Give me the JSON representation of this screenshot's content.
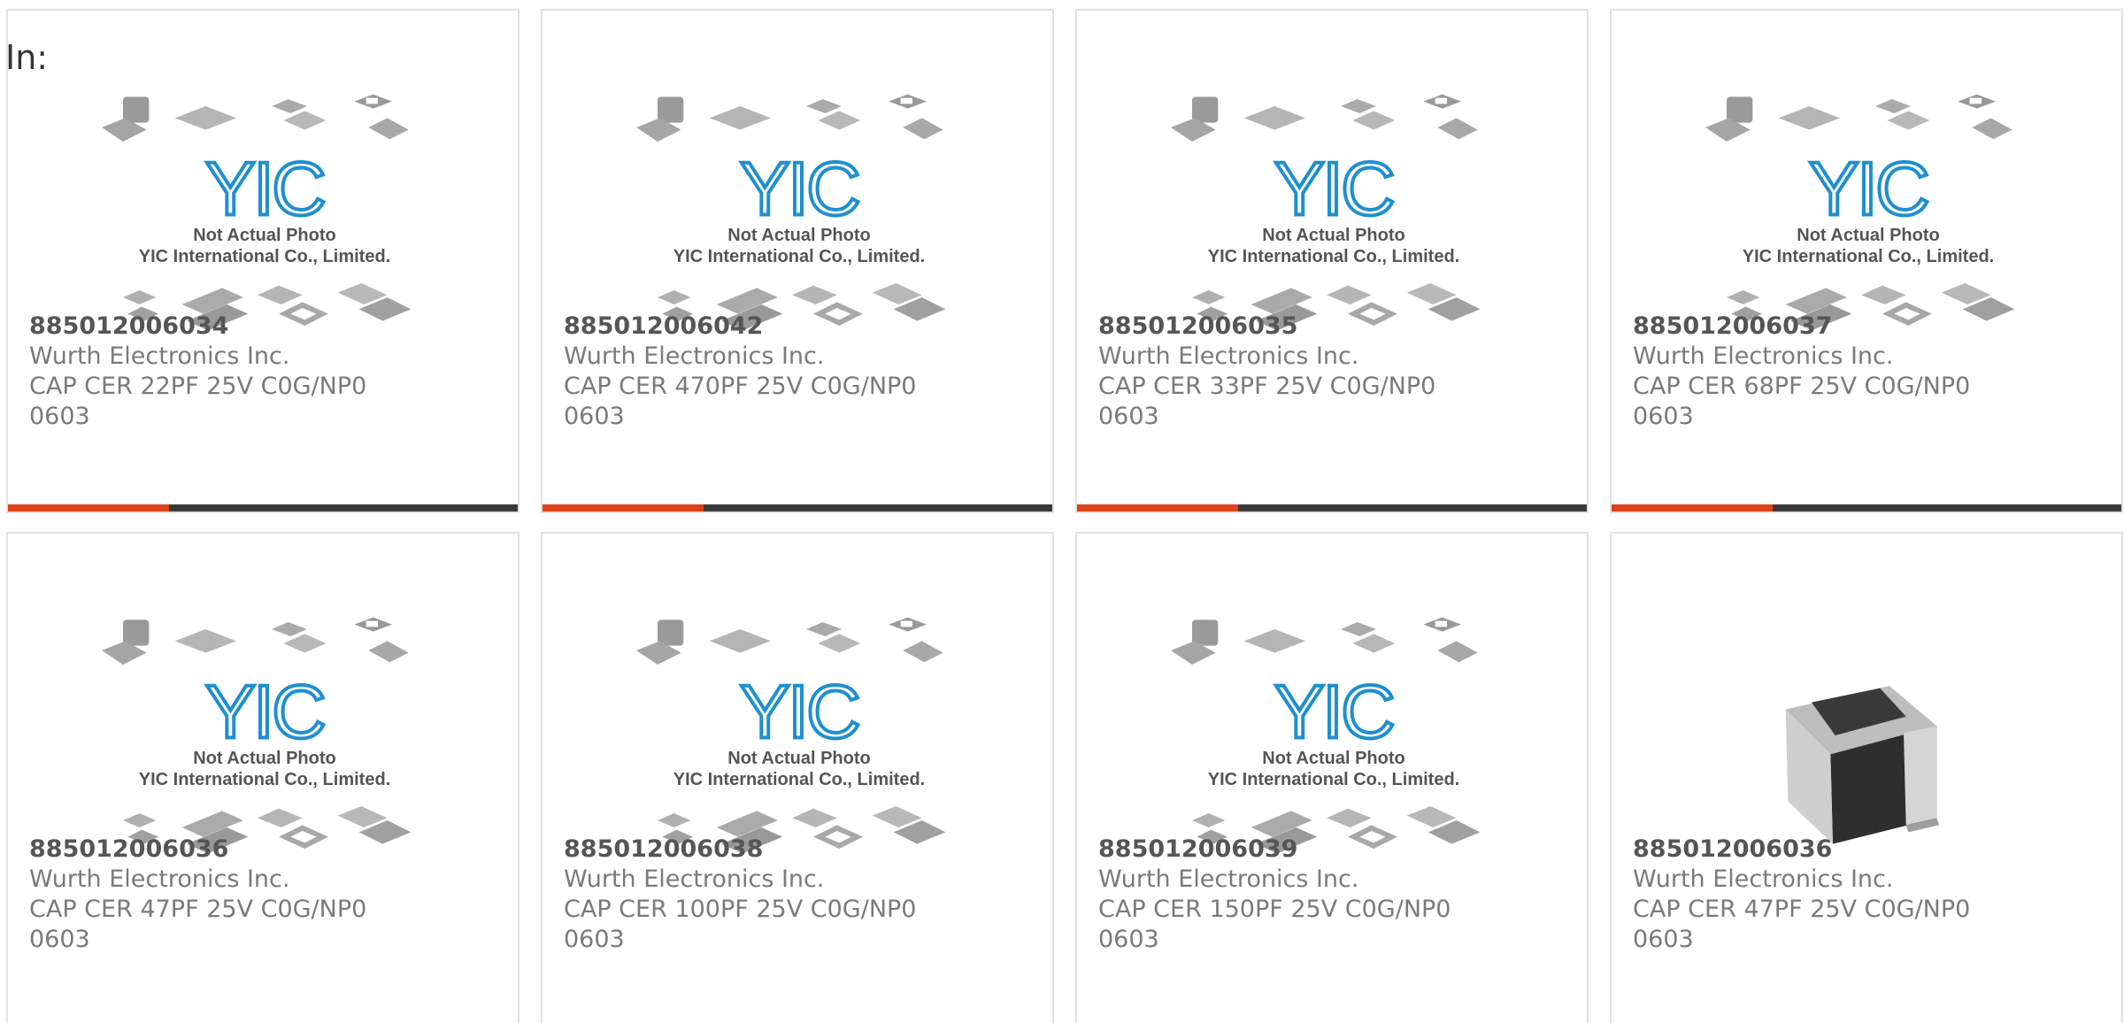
{
  "header": {
    "label": "In:"
  },
  "colors": {
    "accent": "#e0401a",
    "bar": "#3a3a3a",
    "logo": "#1e8fd0"
  },
  "placeholder": {
    "brand": "YIC",
    "line1": "Not Actual Photo",
    "line2": "YIC International Co., Limited."
  },
  "products": [
    {
      "part": "885012006034",
      "manufacturer": "Wurth Electronics Inc.",
      "description": "CAP CER 22PF 25V C0G/NP0\n0603",
      "image": "placeholder"
    },
    {
      "part": "885012006042",
      "manufacturer": "Wurth Electronics Inc.",
      "description": "CAP CER 470PF 25V C0G/NP0\n0603",
      "image": "placeholder"
    },
    {
      "part": "885012006035",
      "manufacturer": "Wurth Electronics Inc.",
      "description": "CAP CER 33PF 25V C0G/NP0\n0603",
      "image": "placeholder"
    },
    {
      "part": "885012006037",
      "manufacturer": "Wurth Electronics Inc.",
      "description": "CAP CER 68PF 25V C0G/NP0\n0603",
      "image": "placeholder"
    },
    {
      "part": "885012006036",
      "manufacturer": "Wurth Electronics Inc.",
      "description": "CAP CER 47PF 25V C0G/NP0\n0603",
      "image": "placeholder"
    },
    {
      "part": "885012006038",
      "manufacturer": "Wurth Electronics Inc.",
      "description": "CAP CER 100PF 25V C0G/NP0\n0603",
      "image": "placeholder"
    },
    {
      "part": "885012006039",
      "manufacturer": "Wurth Electronics Inc.",
      "description": "CAP CER 150PF 25V C0G/NP0\n0603",
      "image": "placeholder"
    },
    {
      "part": "885012006036",
      "manufacturer": "Wurth Electronics Inc.",
      "description": "CAP CER 47PF 25V C0G/NP0\n0603",
      "image": "chip-capacitor-photo"
    }
  ]
}
